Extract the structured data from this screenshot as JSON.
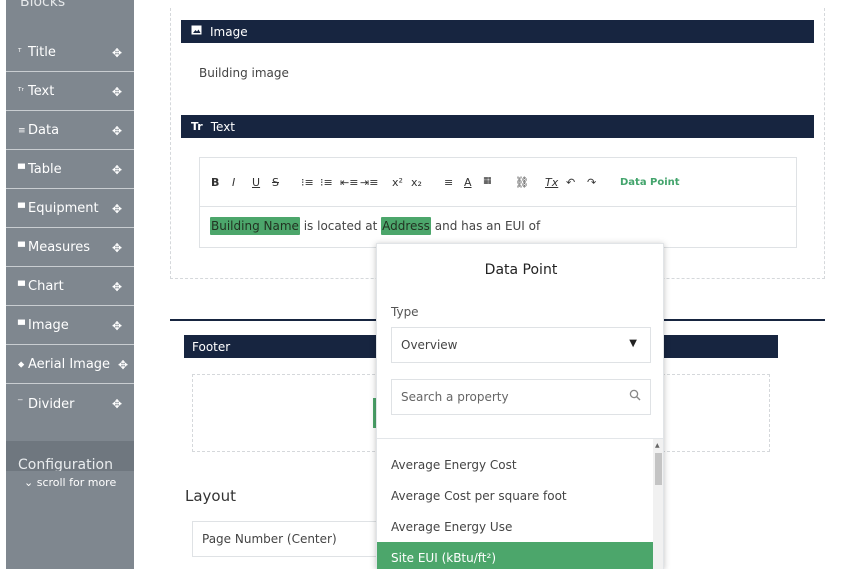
{
  "sidebar": {
    "heading": "Blocks",
    "items": [
      {
        "icon": "ᵀ",
        "label": "Title"
      },
      {
        "icon": "ᵀʳ",
        "label": "Text"
      },
      {
        "icon": "≡",
        "label": "Data"
      },
      {
        "icon": "▀",
        "label": "Table"
      },
      {
        "icon": "▀",
        "label": "Equipment"
      },
      {
        "icon": "▀",
        "label": "Measures"
      },
      {
        "icon": "▀",
        "label": "Chart"
      },
      {
        "icon": "▀",
        "label": "Image"
      },
      {
        "icon": "⬥",
        "label": "Aerial Image"
      },
      {
        "icon": "‾",
        "label": "Divider"
      }
    ],
    "move_glyph": "✥",
    "configuration": "Configuration",
    "scroll_more": "⌄  scroll for more"
  },
  "blocks": {
    "image_header": "Image",
    "image_caption": "Building image",
    "text_header": "Text",
    "text_icon": "Tr"
  },
  "toolbar": {
    "buttons": [
      "B",
      "I",
      "U",
      "S",
      "⁝≡",
      "⁝≡",
      "⇤≡",
      "⇥≡",
      "x²",
      "x₂",
      "≡",
      "A",
      "▦",
      "⛓",
      "Tx",
      "↶",
      "↷"
    ],
    "data_point": "Data Point"
  },
  "editor_content": {
    "chip1": "Building Name",
    "seg1": " is located at ",
    "chip2": "Address",
    "seg2": " and has an EUI of"
  },
  "footer": {
    "header": "Footer"
  },
  "layout": {
    "label": "Layout",
    "page_number": "Page Number (Center)"
  },
  "popup": {
    "title": "Data Point",
    "type_label": "Type",
    "type_value": "Overview",
    "search_placeholder": "Search a property",
    "options": [
      "Average Energy Cost",
      "Average Cost per square foot",
      "Average Energy Use",
      "Site EUI (kBtu/ft²)"
    ],
    "selected_index": 3
  },
  "colors": {
    "navy": "#172540",
    "green": "#4ca66b",
    "sidebar": "#7f878f"
  }
}
